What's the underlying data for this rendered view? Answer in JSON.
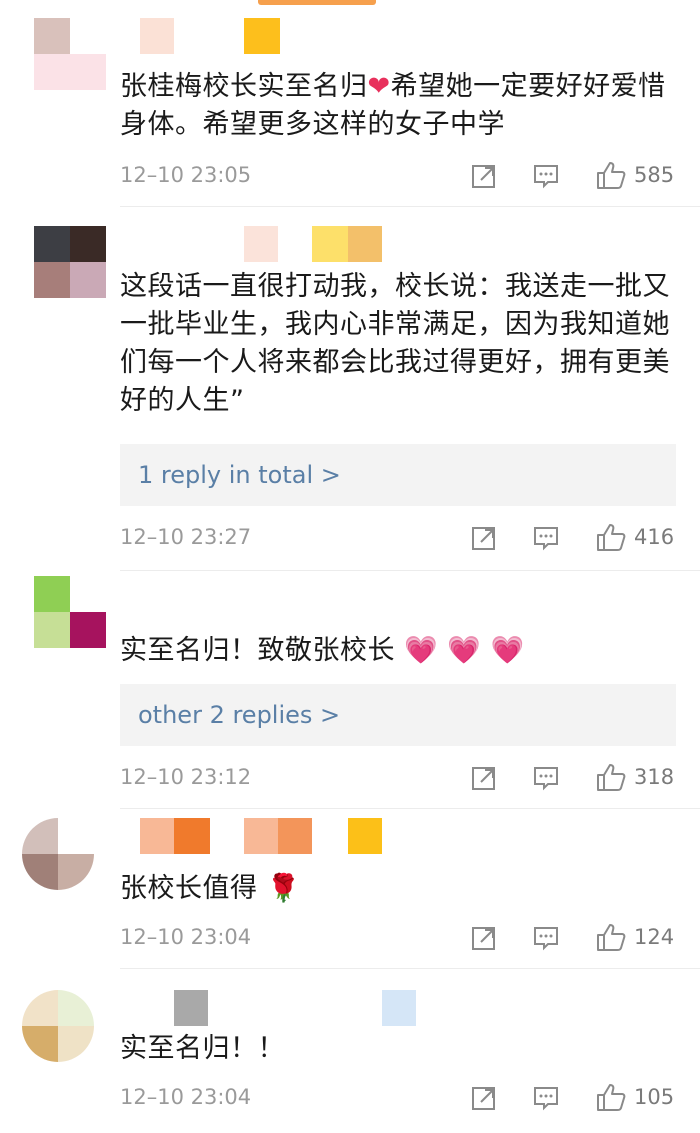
{
  "comments": [
    {
      "text": "张桂梅校长实至名归",
      "text_after": "希望她一定要好好爱惜身体。希望更多这样的女子中学",
      "timestamp": "12–10 23:05",
      "likes": "585"
    },
    {
      "text": "这段话一直很打动我，校长说：我送走一批又一批毕业生，我内心非常满足，因为我知道她们每一个人将来都会比我过得更好，拥有更美好的人生”",
      "reply_label": "1 reply in total >",
      "timestamp": "12–10 23:27",
      "likes": "416"
    },
    {
      "text": "实至名归！致敬张校长",
      "reply_label": "other 2 replies >",
      "timestamp": "12–10 23:12",
      "likes": "318"
    },
    {
      "text": "张校长值得",
      "timestamp": "12–10 23:04",
      "likes": "124"
    },
    {
      "text": "实至名归！！",
      "timestamp": "12–10 23:04",
      "likes": "105"
    }
  ],
  "icons": {
    "share": "share-icon",
    "comment": "comment-icon",
    "like": "like-icon",
    "heart": "red-heart-icon",
    "hearts": "heart-hands-icon",
    "rose": "rose-icon"
  },
  "colors": {
    "link": "#5a7fa6",
    "timestamp": "#9a9a9a",
    "reply_bg": "#f3f3f3"
  }
}
